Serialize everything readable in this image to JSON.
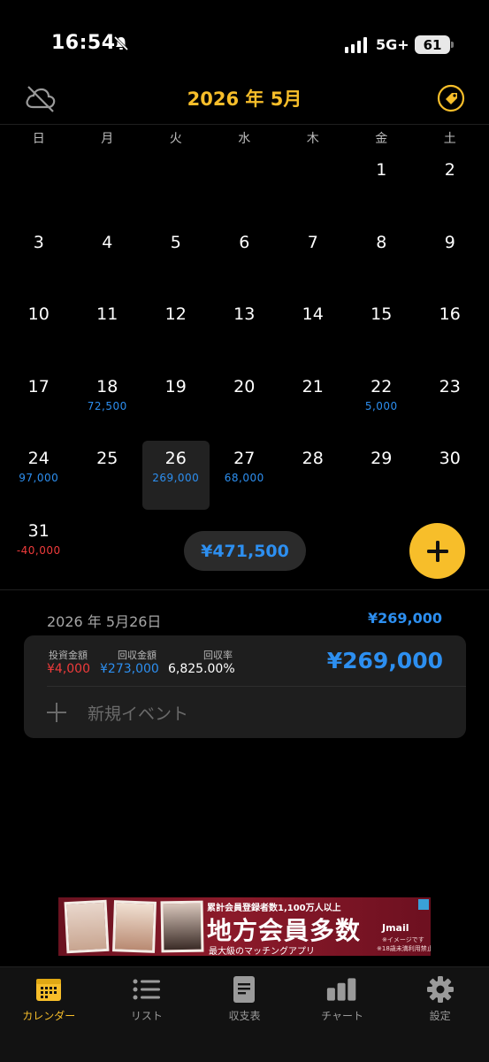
{
  "status_bar": {
    "time": "16:54",
    "network": "5G+",
    "battery": "61"
  },
  "header": {
    "title": "2026 年 5月"
  },
  "weekdays": [
    "日",
    "月",
    "火",
    "水",
    "木",
    "金",
    "土"
  ],
  "calendar": {
    "cells": [
      {
        "day": "",
        "amount": ""
      },
      {
        "day": "",
        "amount": ""
      },
      {
        "day": "",
        "amount": ""
      },
      {
        "day": "",
        "amount": ""
      },
      {
        "day": "",
        "amount": ""
      },
      {
        "day": "1",
        "amount": ""
      },
      {
        "day": "2",
        "amount": ""
      },
      {
        "day": "3",
        "amount": ""
      },
      {
        "day": "4",
        "amount": ""
      },
      {
        "day": "5",
        "amount": ""
      },
      {
        "day": "6",
        "amount": ""
      },
      {
        "day": "7",
        "amount": ""
      },
      {
        "day": "8",
        "amount": ""
      },
      {
        "day": "9",
        "amount": ""
      },
      {
        "day": "10",
        "amount": ""
      },
      {
        "day": "11",
        "amount": ""
      },
      {
        "day": "12",
        "amount": ""
      },
      {
        "day": "13",
        "amount": ""
      },
      {
        "day": "14",
        "amount": ""
      },
      {
        "day": "15",
        "amount": ""
      },
      {
        "day": "16",
        "amount": ""
      },
      {
        "day": "17",
        "amount": ""
      },
      {
        "day": "18",
        "amount": "72,500"
      },
      {
        "day": "19",
        "amount": ""
      },
      {
        "day": "20",
        "amount": ""
      },
      {
        "day": "21",
        "amount": ""
      },
      {
        "day": "22",
        "amount": "5,000"
      },
      {
        "day": "23",
        "amount": ""
      },
      {
        "day": "24",
        "amount": "97,000"
      },
      {
        "day": "25",
        "amount": ""
      },
      {
        "day": "26",
        "amount": "269,000",
        "selected": true
      },
      {
        "day": "27",
        "amount": "68,000"
      },
      {
        "day": "28",
        "amount": ""
      },
      {
        "day": "29",
        "amount": ""
      },
      {
        "day": "30",
        "amount": ""
      },
      {
        "day": "31",
        "amount": "-40,000",
        "negative": true
      }
    ],
    "month_total": "¥471,500"
  },
  "detail": {
    "date": "2026 年 5月26日",
    "total": "¥269,000",
    "entry": {
      "invest_label": "投資金額",
      "invest_value": "¥4,000",
      "return_label": "回収金額",
      "return_value": "¥273,000",
      "rate_label": "回収率",
      "rate_value": "6,825.00%",
      "profit": "¥269,000"
    },
    "new_event_label": "新規イベント"
  },
  "ad": {
    "line1": "累計会員登録者数1,100万人以上",
    "main": "地方会員多数",
    "sub": "最大級のマッチングアプリ",
    "brand": "Jmail",
    "note1": "※イメージです",
    "note2": "※18歳未満利用禁止"
  },
  "tabs": [
    {
      "label": "カレンダー",
      "icon": "calendar-icon",
      "active": true
    },
    {
      "label": "リスト",
      "icon": "list-icon"
    },
    {
      "label": "収支表",
      "icon": "document-icon"
    },
    {
      "label": "チャート",
      "icon": "bar-chart-icon"
    },
    {
      "label": "設定",
      "icon": "gear-icon"
    }
  ],
  "colors": {
    "accent": "#f7be2a",
    "positive": "#2d8ff0",
    "negative": "#ef3b3b",
    "background": "#000000"
  }
}
